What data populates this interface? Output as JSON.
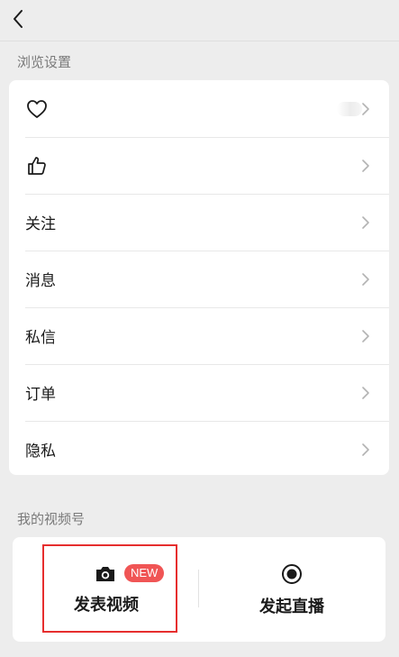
{
  "header": {
    "back_icon": "chevron-left-icon"
  },
  "browse_settings": {
    "title": "浏览设置",
    "items": [
      {
        "icon": "heart-icon",
        "label": ""
      },
      {
        "icon": "thumbs-up-icon",
        "label": ""
      },
      {
        "label": "关注"
      },
      {
        "label": "消息"
      },
      {
        "label": "私信"
      },
      {
        "label": "订单"
      },
      {
        "label": "隐私"
      }
    ]
  },
  "channels": {
    "title": "我的视频号",
    "publish_video_label": "发表视频",
    "new_badge": "NEW",
    "live_label": "发起直播"
  },
  "colors": {
    "background": "#ededed",
    "card": "#ffffff",
    "badge": "#f05555",
    "highlight": "#e62e2e"
  }
}
